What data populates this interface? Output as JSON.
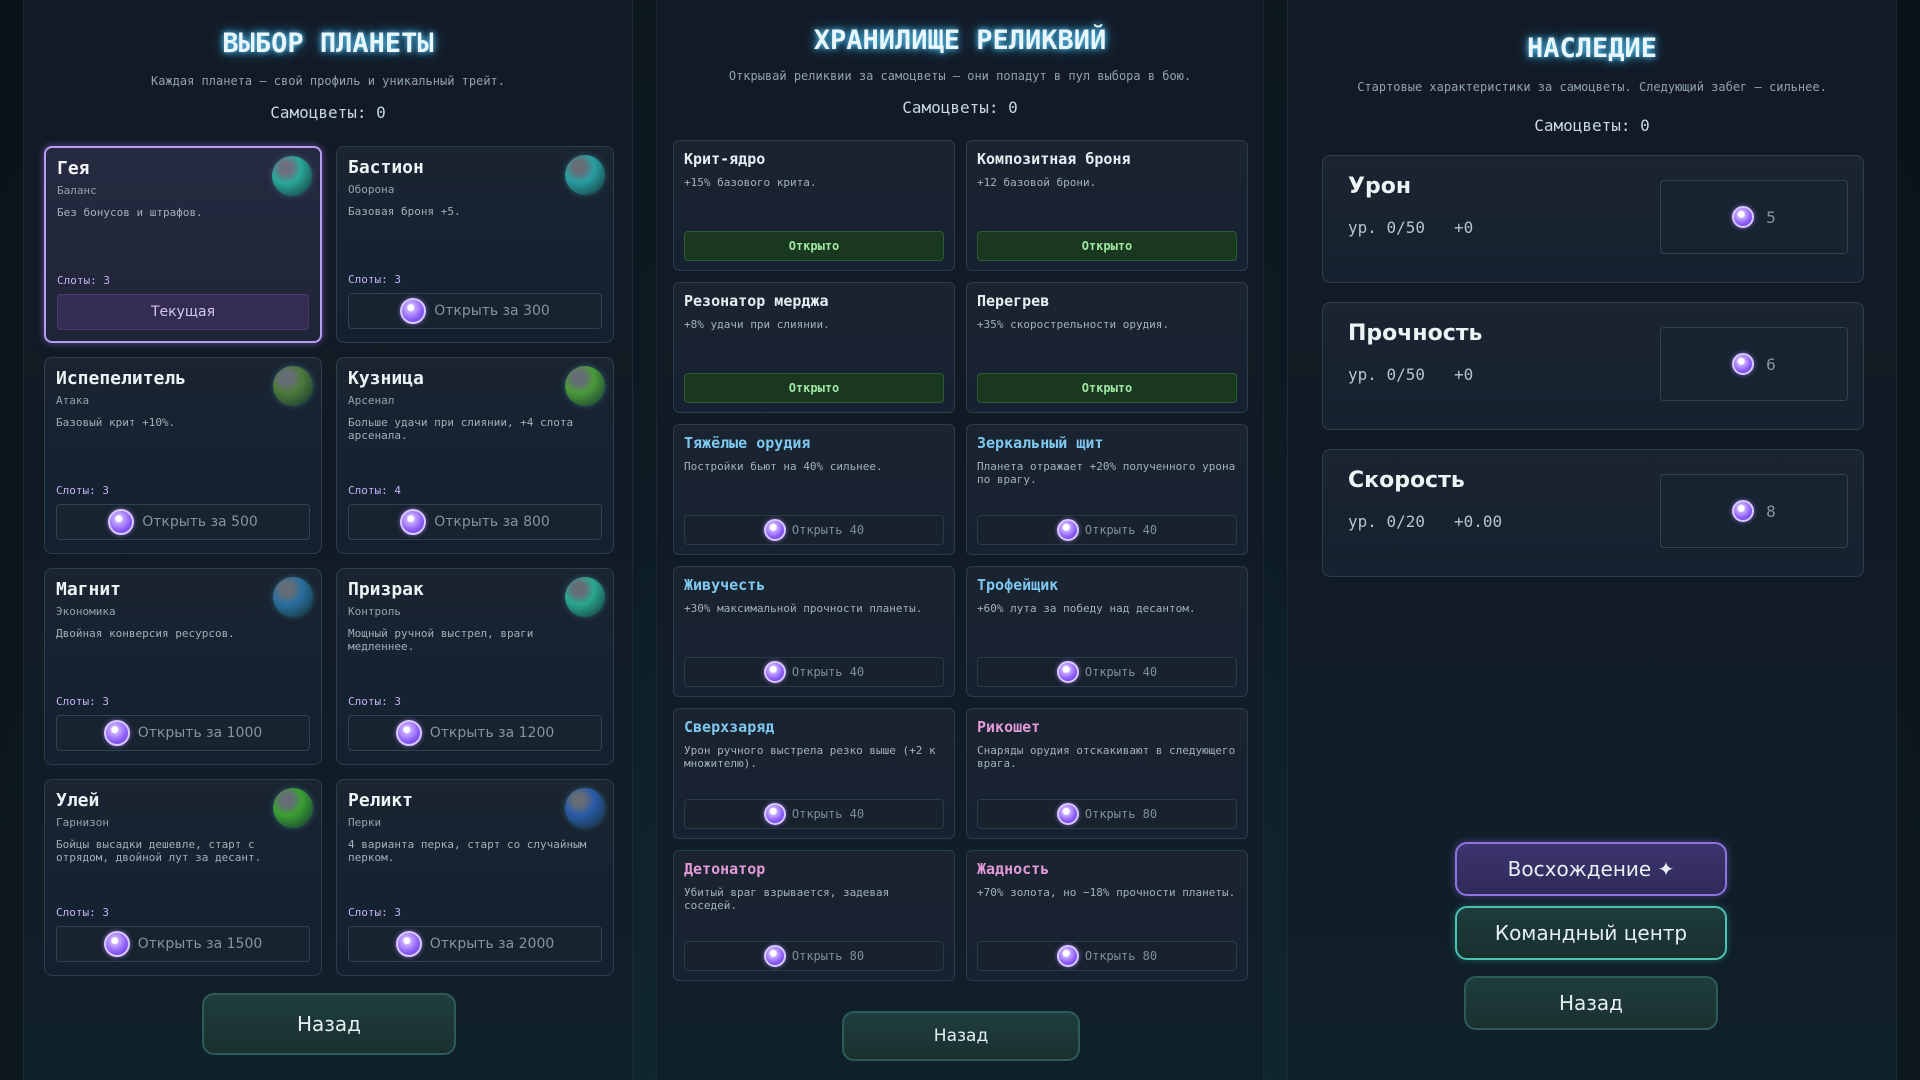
{
  "planets_panel": {
    "title": "ВЫБОР ПЛАНЕТЫ",
    "subtitle": "Каждая планета — свой профиль и уникальный трейт.",
    "gems": "Самоцветы: 0",
    "back": "Назад",
    "cards": [
      {
        "name": "Гея",
        "role": "Баланс",
        "desc": "Без бонусов и штрафов.",
        "slots": "Слоты: 3",
        "action": "Текущая",
        "current": true,
        "color": "#2aa89a"
      },
      {
        "name": "Бастион",
        "role": "Оборона",
        "desc": "Базовая броня +5.",
        "slots": "Слоты: 3",
        "action": "Открыть за 300",
        "current": false,
        "color": "#2a9fa4"
      },
      {
        "name": "Испепелитель",
        "role": "Атака",
        "desc": "Базовый крит +10%.",
        "slots": "Слоты: 3",
        "action": "Открыть за 500",
        "current": false,
        "color": "#4d7a3a"
      },
      {
        "name": "Кузница",
        "role": "Арсенал",
        "desc": "Больше удачи при слиянии, +4 слота арсенала.",
        "slots": "Слоты: 4",
        "action": "Открыть за 800",
        "current": false,
        "color": "#4a9a3a"
      },
      {
        "name": "Магнит",
        "role": "Экономика",
        "desc": "Двойная конверсия ресурсов.",
        "slots": "Слоты: 3",
        "action": "Открыть за 1000",
        "current": false,
        "color": "#2a6fa0"
      },
      {
        "name": "Призрак",
        "role": "Контроль",
        "desc": "Мощный ручной выстрел, враги медленнее.",
        "slots": "Слоты: 3",
        "action": "Открыть за 1200",
        "current": false,
        "color": "#2aa890"
      },
      {
        "name": "Улей",
        "role": "Гарнизон",
        "desc": "Бойцы высадки дешевле, старт с отрядом, двойной лут за десант.",
        "slots": "Слоты: 3",
        "action": "Открыть за 1500",
        "current": false,
        "color": "#3aa033"
      },
      {
        "name": "Реликт",
        "role": "Перки",
        "desc": "4 варианта перка, старт со случайным перком.",
        "slots": "Слоты: 3",
        "action": "Открыть за 2000",
        "current": false,
        "color": "#2a5aa8"
      }
    ]
  },
  "relics_panel": {
    "title": "ХРАНИЛИЩЕ РЕЛИКВИЙ",
    "subtitle": "Открывай реликвии за самоцветы — они попадут в пул выбора в бою.",
    "gems": "Самоцветы: 0",
    "back": "Назад",
    "cards": [
      {
        "name": "Крит-ядро",
        "desc": "+15% базового крита.",
        "action": "Открыто",
        "open": true,
        "tint": "white"
      },
      {
        "name": "Композитная броня",
        "desc": "+12 базовой брони.",
        "action": "Открыто",
        "open": true,
        "tint": "white"
      },
      {
        "name": "Резонатор мерджа",
        "desc": "+8% удачи при слиянии.",
        "action": "Открыто",
        "open": true,
        "tint": "white"
      },
      {
        "name": "Перегрев",
        "desc": "+35% скорострельности орудия.",
        "action": "Открыто",
        "open": true,
        "tint": "white"
      },
      {
        "name": "Тяжёлые орудия",
        "desc": "Постройки бьют на 40% сильнее.",
        "action": "Открыть 40",
        "open": false,
        "tint": "blue"
      },
      {
        "name": "Зеркальный щит",
        "desc": "Планета отражает +20% полученного урона по врагу.",
        "action": "Открыть 40",
        "open": false,
        "tint": "blue"
      },
      {
        "name": "Живучесть",
        "desc": "+30% максимальной прочности планеты.",
        "action": "Открыть 40",
        "open": false,
        "tint": "blue"
      },
      {
        "name": "Трофейщик",
        "desc": "+60% лута за победу над десантом.",
        "action": "Открыть 40",
        "open": false,
        "tint": "blue"
      },
      {
        "name": "Сверхзаряд",
        "desc": "Урон ручного выстрела резко выше (+2 к множителю).",
        "action": "Открыть 40",
        "open": false,
        "tint": "blue"
      },
      {
        "name": "Рикошет",
        "desc": "Снаряды орудия отскакивают в следующего врага.",
        "action": "Открыть 80",
        "open": false,
        "tint": "pink"
      },
      {
        "name": "Детонатор",
        "desc": "Убитый враг взрывается, задевая соседей.",
        "action": "Открыть 80",
        "open": false,
        "tint": "pink"
      },
      {
        "name": "Жадность",
        "desc": "+70% золота, но −18% прочности планеты.",
        "action": "Открыть 80",
        "open": false,
        "tint": "pink"
      }
    ]
  },
  "legacy_panel": {
    "title": "НАСЛЕДИЕ",
    "subtitle": "Стартовые характеристики за самоцветы. Следующий забег — сильнее.",
    "gems": "Самоцветы: 0",
    "stats": [
      {
        "name": "Урон",
        "level": "ур. 0/50",
        "bonus": "+0",
        "cost": "5"
      },
      {
        "name": "Прочность",
        "level": "ур. 0/50",
        "bonus": "+0",
        "cost": "6"
      },
      {
        "name": "Скорость",
        "level": "ур. 0/20",
        "bonus": "+0.00",
        "cost": "8"
      }
    ],
    "ascend": "Восхождение ✦",
    "command": "Командный центр",
    "back": "Назад"
  }
}
